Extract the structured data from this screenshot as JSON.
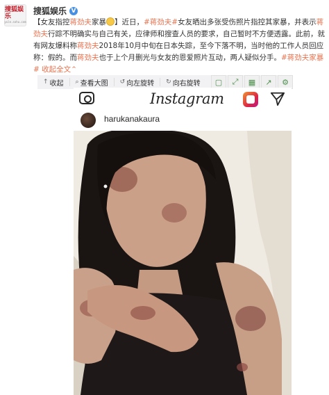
{
  "account": {
    "name": "搜狐娱乐",
    "logo_text": "搜狐娱乐",
    "logo_sub": "yule.sohu.com",
    "verified_mark": "V"
  },
  "post": {
    "segments": [
      {
        "t": "【女友指控",
        "c": "n"
      },
      {
        "t": "蒋劲夫",
        "c": "tag"
      },
      {
        "t": "家暴",
        "c": "n"
      },
      {
        "t": "EMOJI",
        "c": "emoji"
      },
      {
        "t": "】近日，",
        "c": "n"
      },
      {
        "t": "#蒋劲夫#",
        "c": "tag"
      },
      {
        "t": "女友晒出多张受伤照片指控其家暴，并表示",
        "c": "n"
      },
      {
        "t": "蒋劲夫",
        "c": "tag"
      },
      {
        "t": "行踪不明确实与自己有关，应律师和搜查人员的要求，自己暂时不方便透露。此前，就有网友爆料称",
        "c": "n"
      },
      {
        "t": "蒋劲夫",
        "c": "tag"
      },
      {
        "t": "2018年10月中旬在日本失踪，至今下落不明，当时他的工作人员回应称：假的。而",
        "c": "n"
      },
      {
        "t": "蒋劲夫",
        "c": "tag"
      },
      {
        "t": "也于上个月删光与女友的恩爱照片互动，两人疑似分手。",
        "c": "n"
      },
      {
        "t": "#蒋劲夫家暴#",
        "c": "tag"
      },
      {
        "t": " 收起全文",
        "c": "link"
      },
      {
        "t": "⌃",
        "c": "link"
      }
    ]
  },
  "toolbar": {
    "collapse": "收起",
    "view_large": "查看大图",
    "rotate_left": "向左旋转",
    "rotate_right": "向右旋转",
    "collapse_icon": "collapse-icon",
    "zoom_icon": "zoom-icon",
    "rotate_left_icon": "rotate-left-icon",
    "rotate_right_icon": "rotate-right-icon"
  },
  "instagram": {
    "logo": "Instagram",
    "username": "harukanakaura"
  },
  "colors": {
    "tag": "#eb7350",
    "verified": "#4a90e2",
    "brand_red": "#c21f2b"
  }
}
